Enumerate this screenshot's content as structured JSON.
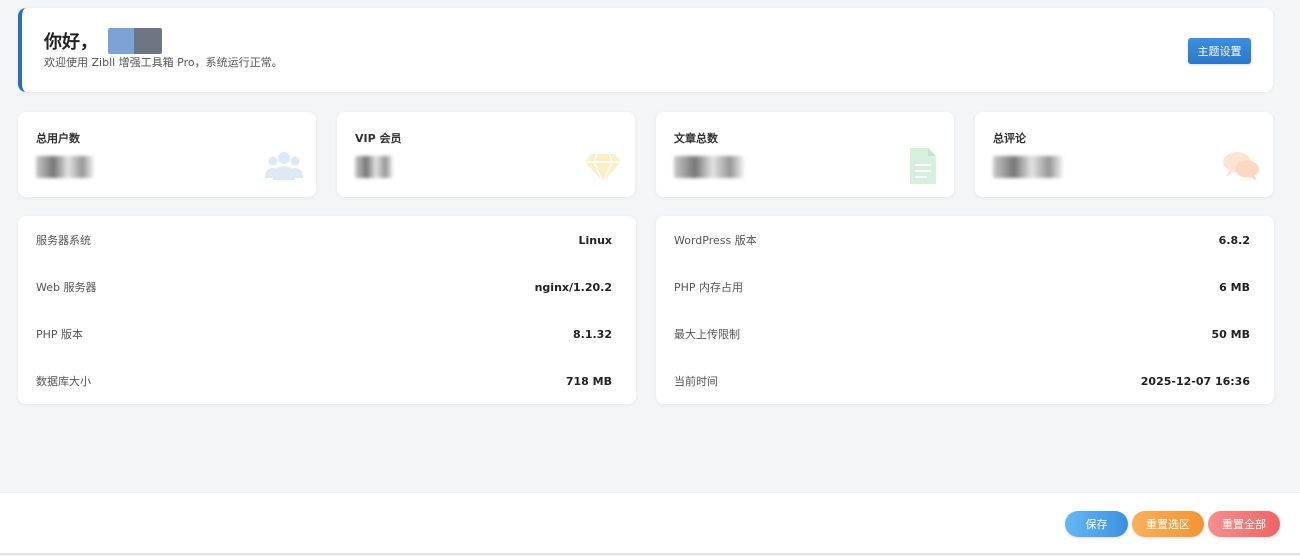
{
  "welcome": {
    "greeting": "你好，",
    "subtitle": "欢迎使用 Zibll 增强工具箱 Pro，系统运行正常。",
    "theme_button": "主题设置"
  },
  "stats": [
    {
      "label": "总用户数",
      "icon": "users-icon",
      "icon_color": "#dde9f5"
    },
    {
      "label": "VIP 会员",
      "icon": "diamond-icon",
      "icon_color": "#fbefc8"
    },
    {
      "label": "文章总数",
      "icon": "document-icon",
      "icon_color": "#d5f0dd"
    },
    {
      "label": "总评论",
      "icon": "chat-icon",
      "icon_color": "#fde3d2"
    }
  ],
  "server_info": [
    {
      "key": "服务器系统",
      "value": "Linux"
    },
    {
      "key": "Web 服务器",
      "value": "nginx/1.20.2"
    },
    {
      "key": "PHP 版本",
      "value": "8.1.32"
    },
    {
      "key": "数据库大小",
      "value": "718 MB"
    }
  ],
  "wp_info": [
    {
      "key": "WordPress 版本",
      "value": "6.8.2"
    },
    {
      "key": "PHP 内存占用",
      "value": "6 MB"
    },
    {
      "key": "最大上传限制",
      "value": "50 MB"
    },
    {
      "key": "当前时间",
      "value": "2025-12-07 16:36"
    }
  ],
  "footer": {
    "save": "保存",
    "reset_section": "重置选区",
    "reset_all": "重置全部"
  },
  "colors": {
    "accent": "#2a6fb0",
    "save": "#3d8fde",
    "reset_section": "#f19433",
    "reset_all": "#ec6565"
  }
}
